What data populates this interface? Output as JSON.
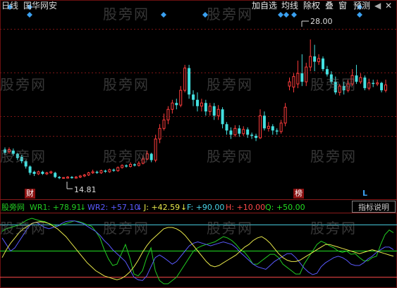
{
  "toolbar": {
    "period": "日线",
    "symbol": "国华网安",
    "buttons": [
      "加自选",
      "均线",
      "除权",
      "叠",
      "窗",
      "预测"
    ],
    "close_glyph": "✕"
  },
  "watermark": "股旁网",
  "markers": {
    "high_price": "28.00",
    "low_price": "14.81",
    "tag_cai": "财",
    "tag_bang": "榜",
    "tag_l": "L"
  },
  "indicator": {
    "name": "股旁网",
    "items": [
      {
        "label": "WR1: +78.91",
        "arrow": "↓",
        "color": "#22cc22"
      },
      {
        "label": "WR2: +57.10",
        "arrow": "↓",
        "color": "#5a5aff"
      },
      {
        "label": "J: +42.59",
        "arrow": "↓",
        "color": "#e8e84a"
      },
      {
        "label": "F: +90.00",
        "arrow": "",
        "color": "#4ad4e8"
      },
      {
        "label": "H: +10.00",
        "arrow": "",
        "color": "#ff4a4a"
      },
      {
        "label": "Q: +50.00",
        "arrow": "",
        "color": "#22dd22"
      }
    ],
    "help_button": "指标说明"
  },
  "colors": {
    "up": "#ff3c3c",
    "down": "#44e0e0",
    "marker": "#3aa0f0",
    "grid": "#7a1515"
  },
  "chart_data": {
    "type": "candlestick",
    "price_range": [
      13.5,
      30.0
    ],
    "candles": [
      {
        "o": 17.6,
        "c": 17.3,
        "h": 17.8,
        "l": 17.1
      },
      {
        "o": 17.4,
        "c": 17.6,
        "h": 17.8,
        "l": 17.2
      },
      {
        "o": 17.5,
        "c": 17.2,
        "h": 17.7,
        "l": 17.0
      },
      {
        "o": 17.2,
        "c": 16.8,
        "h": 17.3,
        "l": 16.6
      },
      {
        "o": 16.9,
        "c": 16.5,
        "h": 17.1,
        "l": 16.3
      },
      {
        "o": 16.5,
        "c": 16.0,
        "h": 16.6,
        "l": 15.8
      },
      {
        "o": 16.0,
        "c": 15.4,
        "h": 16.1,
        "l": 15.2
      },
      {
        "o": 15.5,
        "c": 15.3,
        "h": 15.6,
        "l": 15.1
      },
      {
        "o": 15.3,
        "c": 15.5,
        "h": 15.6,
        "l": 15.2
      },
      {
        "o": 15.5,
        "c": 15.3,
        "h": 15.6,
        "l": 15.2
      },
      {
        "o": 15.3,
        "c": 15.4,
        "h": 15.5,
        "l": 15.2
      },
      {
        "o": 15.4,
        "c": 15.5,
        "h": 15.6,
        "l": 15.3
      },
      {
        "o": 15.4,
        "c": 15.0,
        "h": 15.5,
        "l": 14.9
      },
      {
        "o": 15.0,
        "c": 14.9,
        "h": 15.1,
        "l": 14.81
      },
      {
        "o": 14.9,
        "c": 14.95,
        "h": 15.0,
        "l": 14.85
      },
      {
        "o": 14.9,
        "c": 15.0,
        "h": 15.1,
        "l": 14.85
      },
      {
        "o": 15.0,
        "c": 14.9,
        "h": 15.1,
        "l": 14.85
      },
      {
        "o": 14.9,
        "c": 15.0,
        "h": 15.1,
        "l": 14.85
      },
      {
        "o": 15.0,
        "c": 15.1,
        "h": 15.2,
        "l": 14.9
      },
      {
        "o": 15.1,
        "c": 15.2,
        "h": 15.3,
        "l": 15.0
      },
      {
        "o": 15.2,
        "c": 15.4,
        "h": 15.5,
        "l": 15.1
      },
      {
        "o": 15.4,
        "c": 15.5,
        "h": 15.7,
        "l": 15.3
      },
      {
        "o": 15.5,
        "c": 15.4,
        "h": 15.6,
        "l": 15.3
      },
      {
        "o": 15.4,
        "c": 15.6,
        "h": 15.7,
        "l": 15.3
      },
      {
        "o": 15.6,
        "c": 15.5,
        "h": 15.7,
        "l": 15.4
      },
      {
        "o": 15.5,
        "c": 15.7,
        "h": 15.8,
        "l": 15.4
      },
      {
        "o": 15.7,
        "c": 15.6,
        "h": 15.8,
        "l": 15.5
      },
      {
        "o": 15.6,
        "c": 15.9,
        "h": 16.0,
        "l": 15.5
      },
      {
        "o": 15.9,
        "c": 16.1,
        "h": 16.2,
        "l": 15.8
      },
      {
        "o": 16.1,
        "c": 16.0,
        "h": 16.2,
        "l": 15.9
      },
      {
        "o": 16.0,
        "c": 16.2,
        "h": 16.4,
        "l": 15.9
      },
      {
        "o": 16.2,
        "c": 16.1,
        "h": 16.3,
        "l": 16.0
      },
      {
        "o": 16.1,
        "c": 16.3,
        "h": 16.5,
        "l": 16.0
      },
      {
        "o": 16.3,
        "c": 16.7,
        "h": 17.0,
        "l": 16.2
      },
      {
        "o": 16.7,
        "c": 17.2,
        "h": 17.5,
        "l": 16.6
      },
      {
        "o": 17.2,
        "c": 16.6,
        "h": 17.3,
        "l": 16.4
      },
      {
        "o": 16.6,
        "c": 18.6,
        "h": 19.0,
        "l": 16.4
      },
      {
        "o": 18.6,
        "c": 19.6,
        "h": 20.0,
        "l": 18.2
      },
      {
        "o": 19.6,
        "c": 20.4,
        "h": 21.0,
        "l": 19.4
      },
      {
        "o": 20.4,
        "c": 21.4,
        "h": 21.7,
        "l": 20.0
      },
      {
        "o": 21.4,
        "c": 22.0,
        "h": 22.3,
        "l": 21.0
      },
      {
        "o": 22.0,
        "c": 21.8,
        "h": 22.4,
        "l": 21.4
      },
      {
        "o": 21.8,
        "c": 23.2,
        "h": 23.6,
        "l": 21.6
      },
      {
        "o": 23.2,
        "c": 25.3,
        "h": 25.6,
        "l": 23.0
      },
      {
        "o": 25.3,
        "c": 22.8,
        "h": 25.6,
        "l": 22.4
      },
      {
        "o": 22.8,
        "c": 22.3,
        "h": 23.2,
        "l": 21.7
      },
      {
        "o": 22.3,
        "c": 21.7,
        "h": 23.0,
        "l": 21.2
      },
      {
        "o": 21.7,
        "c": 22.0,
        "h": 22.4,
        "l": 21.2
      },
      {
        "o": 22.0,
        "c": 21.2,
        "h": 22.3,
        "l": 20.8
      },
      {
        "o": 21.2,
        "c": 21.7,
        "h": 22.0,
        "l": 20.8
      },
      {
        "o": 21.7,
        "c": 20.8,
        "h": 22.0,
        "l": 20.4
      },
      {
        "o": 20.8,
        "c": 21.4,
        "h": 21.8,
        "l": 20.4
      },
      {
        "o": 21.4,
        "c": 20.0,
        "h": 21.6,
        "l": 19.6
      },
      {
        "o": 20.0,
        "c": 19.4,
        "h": 20.2,
        "l": 19.0
      },
      {
        "o": 19.4,
        "c": 19.0,
        "h": 19.7,
        "l": 18.6
      },
      {
        "o": 19.0,
        "c": 19.6,
        "h": 19.9,
        "l": 18.8
      },
      {
        "o": 19.6,
        "c": 19.1,
        "h": 19.9,
        "l": 18.8
      },
      {
        "o": 19.1,
        "c": 19.5,
        "h": 19.8,
        "l": 18.9
      },
      {
        "o": 19.5,
        "c": 19.0,
        "h": 19.7,
        "l": 18.7
      },
      {
        "o": 19.0,
        "c": 18.9,
        "h": 19.2,
        "l": 18.6
      },
      {
        "o": 18.9,
        "c": 18.7,
        "h": 19.1,
        "l": 18.4
      },
      {
        "o": 18.7,
        "c": 20.8,
        "h": 21.4,
        "l": 18.6
      },
      {
        "o": 20.8,
        "c": 19.6,
        "h": 21.2,
        "l": 19.4
      },
      {
        "o": 19.6,
        "c": 19.8,
        "h": 20.2,
        "l": 19.3
      },
      {
        "o": 19.8,
        "c": 19.4,
        "h": 20.0,
        "l": 19.0
      },
      {
        "o": 19.4,
        "c": 19.3,
        "h": 19.6,
        "l": 19.0
      },
      {
        "o": 19.3,
        "c": 20.1,
        "h": 20.4,
        "l": 19.1
      },
      {
        "o": 20.1,
        "c": 21.6,
        "h": 22.0,
        "l": 19.8
      },
      {
        "o": 23.6,
        "c": 24.0,
        "h": 24.4,
        "l": 23.2
      },
      {
        "o": 23.5,
        "c": 24.5,
        "h": 24.8,
        "l": 23.0
      },
      {
        "o": 23.8,
        "c": 24.8,
        "h": 26.0,
        "l": 23.4
      },
      {
        "o": 24.8,
        "c": 24.0,
        "h": 26.6,
        "l": 23.6
      },
      {
        "o": 24.0,
        "c": 25.4,
        "h": 25.8,
        "l": 23.6
      },
      {
        "o": 25.4,
        "c": 26.4,
        "h": 28.0,
        "l": 25.0
      },
      {
        "o": 26.4,
        "c": 25.9,
        "h": 27.5,
        "l": 25.0
      },
      {
        "o": 25.9,
        "c": 26.2,
        "h": 26.6,
        "l": 25.6
      },
      {
        "o": 26.2,
        "c": 25.2,
        "h": 26.4,
        "l": 25.0
      },
      {
        "o": 25.2,
        "c": 24.7,
        "h": 25.5,
        "l": 24.5
      },
      {
        "o": 24.7,
        "c": 24.0,
        "h": 25.0,
        "l": 23.8
      },
      {
        "o": 24.0,
        "c": 23.0,
        "h": 24.5,
        "l": 22.8
      },
      {
        "o": 23.0,
        "c": 23.6,
        "h": 23.8,
        "l": 22.7
      },
      {
        "o": 23.6,
        "c": 23.2,
        "h": 24.0,
        "l": 22.8
      },
      {
        "o": 23.2,
        "c": 23.8,
        "h": 24.2,
        "l": 23.0
      },
      {
        "o": 23.8,
        "c": 24.6,
        "h": 25.2,
        "l": 23.6
      },
      {
        "o": 24.6,
        "c": 24.0,
        "h": 25.6,
        "l": 23.8
      },
      {
        "o": 24.0,
        "c": 24.4,
        "h": 24.8,
        "l": 23.8
      },
      {
        "o": 24.4,
        "c": 23.4,
        "h": 24.6,
        "l": 23.2
      },
      {
        "o": 23.4,
        "c": 23.9,
        "h": 24.3,
        "l": 23.2
      },
      {
        "o": 23.9,
        "c": 23.8,
        "h": 24.2,
        "l": 23.5
      },
      {
        "o": 23.8,
        "c": 23.9,
        "h": 24.2,
        "l": 23.6
      },
      {
        "o": 23.9,
        "c": 23.2,
        "h": 24.0,
        "l": 23.0
      },
      {
        "o": 23.2,
        "c": 23.7,
        "h": 24.2,
        "l": 23.0
      }
    ],
    "indicator_lines": {
      "F": 90,
      "Q": 50,
      "H": 10,
      "WR1": [
        80,
        84,
        86,
        88,
        90,
        94,
        98,
        100,
        98,
        96,
        95,
        92,
        90,
        88,
        90,
        92,
        94,
        96,
        95,
        93,
        90,
        88,
        80,
        70,
        52,
        38,
        28,
        30,
        45,
        60,
        40,
        15,
        12,
        20,
        40,
        55,
        20,
        5,
        0,
        0,
        5,
        10,
        20,
        30,
        40,
        50,
        55,
        58,
        60,
        62,
        64,
        68,
        72,
        70,
        66,
        60,
        52,
        48,
        40,
        30,
        30,
        35,
        40,
        45,
        45,
        40,
        30,
        25,
        20,
        15,
        15,
        30,
        40,
        50,
        60,
        65,
        62,
        58,
        55,
        50,
        48,
        50,
        45,
        46,
        40,
        35,
        35,
        40,
        42,
        60,
        75,
        82,
        78
      ],
      "WR2": [
        70,
        60,
        50,
        55,
        65,
        75,
        85,
        92,
        94,
        90,
        86,
        84,
        86,
        88,
        92,
        95,
        96,
        96,
        94,
        92,
        88,
        84,
        80,
        74,
        66,
        60,
        52,
        46,
        40,
        34,
        22,
        10,
        6,
        5,
        12,
        26,
        40,
        44,
        40,
        35,
        30,
        34,
        42,
        50,
        58,
        62,
        64,
        62,
        60,
        58,
        60,
        62,
        64,
        62,
        60,
        55,
        48,
        42,
        36,
        30,
        26,
        24,
        22,
        28,
        34,
        38,
        42,
        46,
        46,
        40,
        32,
        24,
        18,
        14,
        16,
        26,
        32,
        36,
        40,
        42,
        40,
        36,
        30,
        28,
        28,
        32,
        38,
        42,
        48,
        52,
        56,
        56,
        52
      ],
      "J": [
        40,
        52,
        62,
        70,
        78,
        84,
        88,
        92,
        94,
        95,
        94,
        92,
        88,
        84,
        78,
        72,
        64,
        56,
        48,
        40,
        32,
        26,
        20,
        16,
        12,
        10,
        8,
        6,
        8,
        12,
        18,
        26,
        36,
        48,
        58,
        66,
        72,
        78,
        84,
        86,
        86,
        84,
        80,
        74,
        66,
        58,
        50,
        42,
        34,
        28,
        26,
        28,
        32,
        36,
        40,
        44,
        50,
        56,
        60,
        66,
        70,
        72,
        68,
        62,
        54,
        46,
        40,
        36,
        34,
        34,
        36,
        40,
        44,
        48,
        52,
        56,
        60,
        60,
        58,
        56,
        54,
        52,
        50,
        48,
        46,
        48,
        50,
        52,
        50,
        48,
        46,
        44,
        42
      ]
    }
  }
}
